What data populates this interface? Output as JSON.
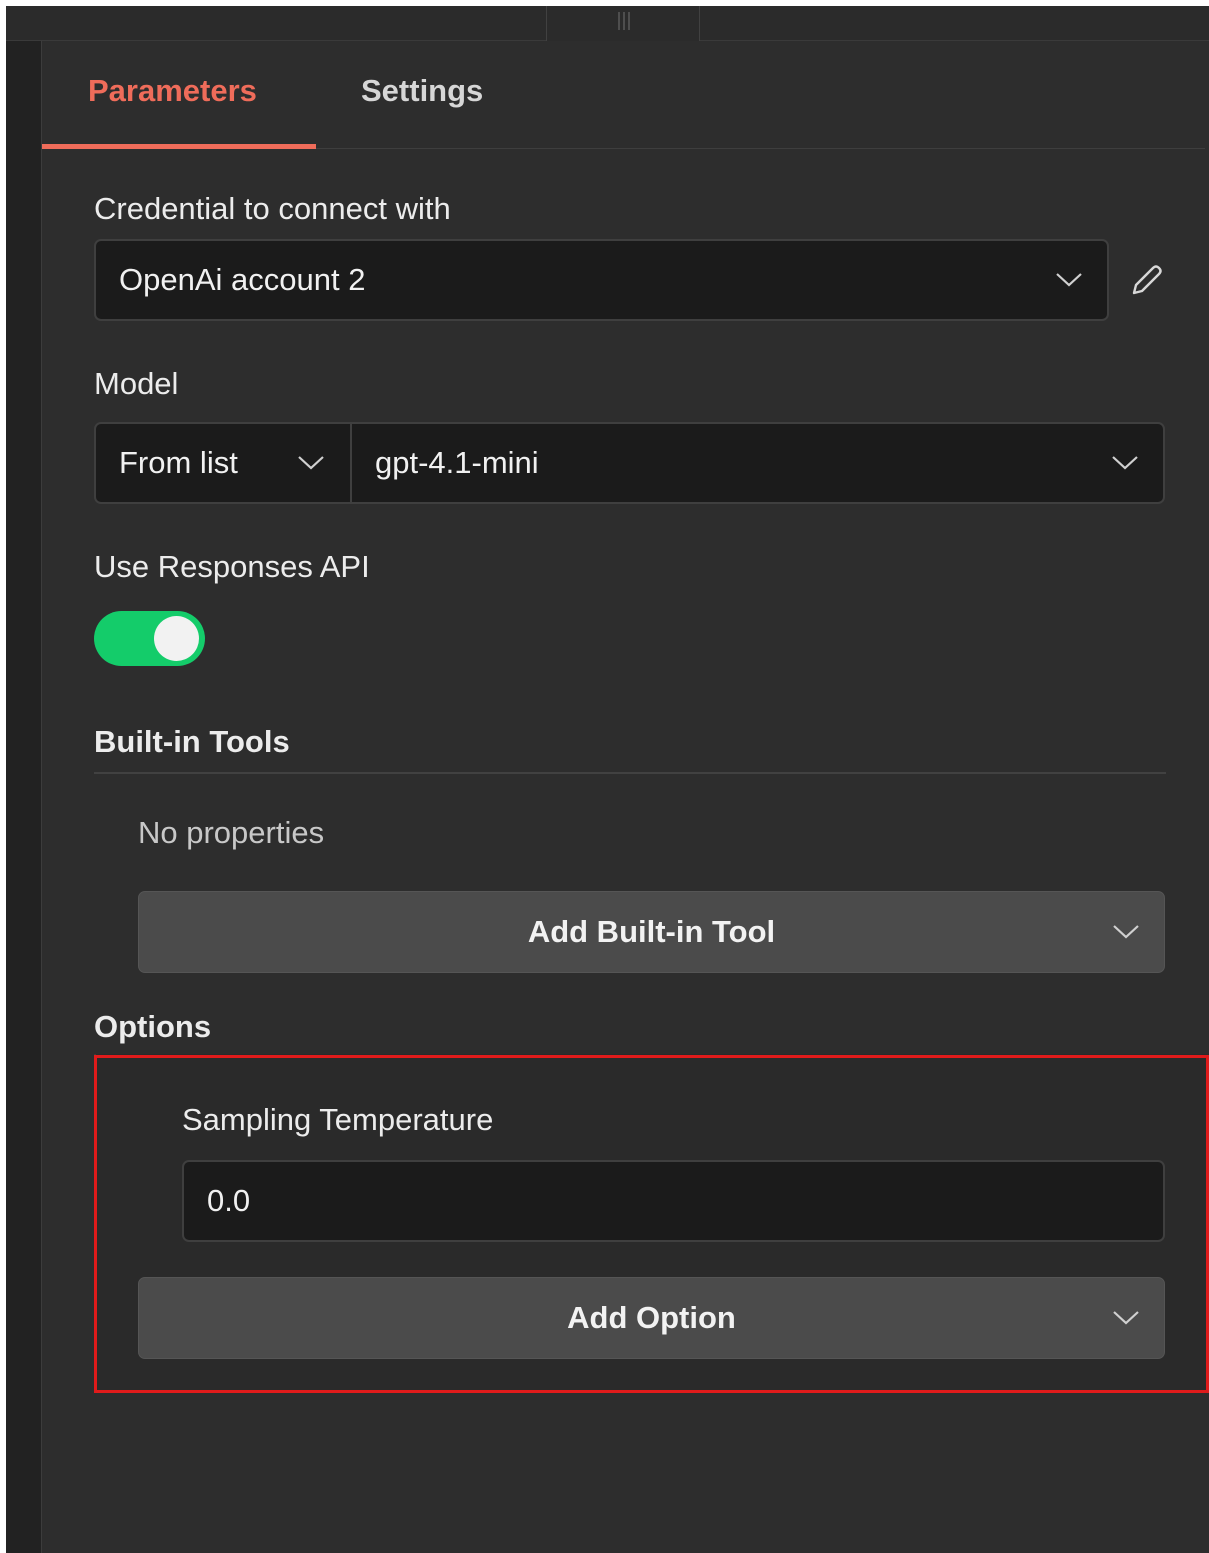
{
  "tabs": {
    "parameters": "Parameters",
    "settings": "Settings"
  },
  "credential": {
    "label": "Credential to connect with",
    "value": "OpenAi account 2"
  },
  "model": {
    "label": "Model",
    "mode": "From list",
    "value": "gpt-4.1-mini"
  },
  "responses_api": {
    "label": "Use Responses API",
    "enabled": true
  },
  "builtin_tools": {
    "heading": "Built-in Tools",
    "empty_text": "No properties",
    "add_button": "Add Built-in Tool"
  },
  "options": {
    "heading": "Options",
    "sampling_temperature": {
      "label": "Sampling Temperature",
      "value": "0.0"
    },
    "add_button": "Add Option"
  },
  "colors": {
    "accent": "#ef6c5a",
    "toggle_on": "#14cc6a",
    "highlight": "#e01b1b",
    "panel_bg": "#2d2d2d",
    "field_bg": "#1b1b1b"
  },
  "icons": {
    "dropdown": "chevron-down-icon",
    "edit": "pencil-icon",
    "drag": "grip-vertical-icon"
  }
}
